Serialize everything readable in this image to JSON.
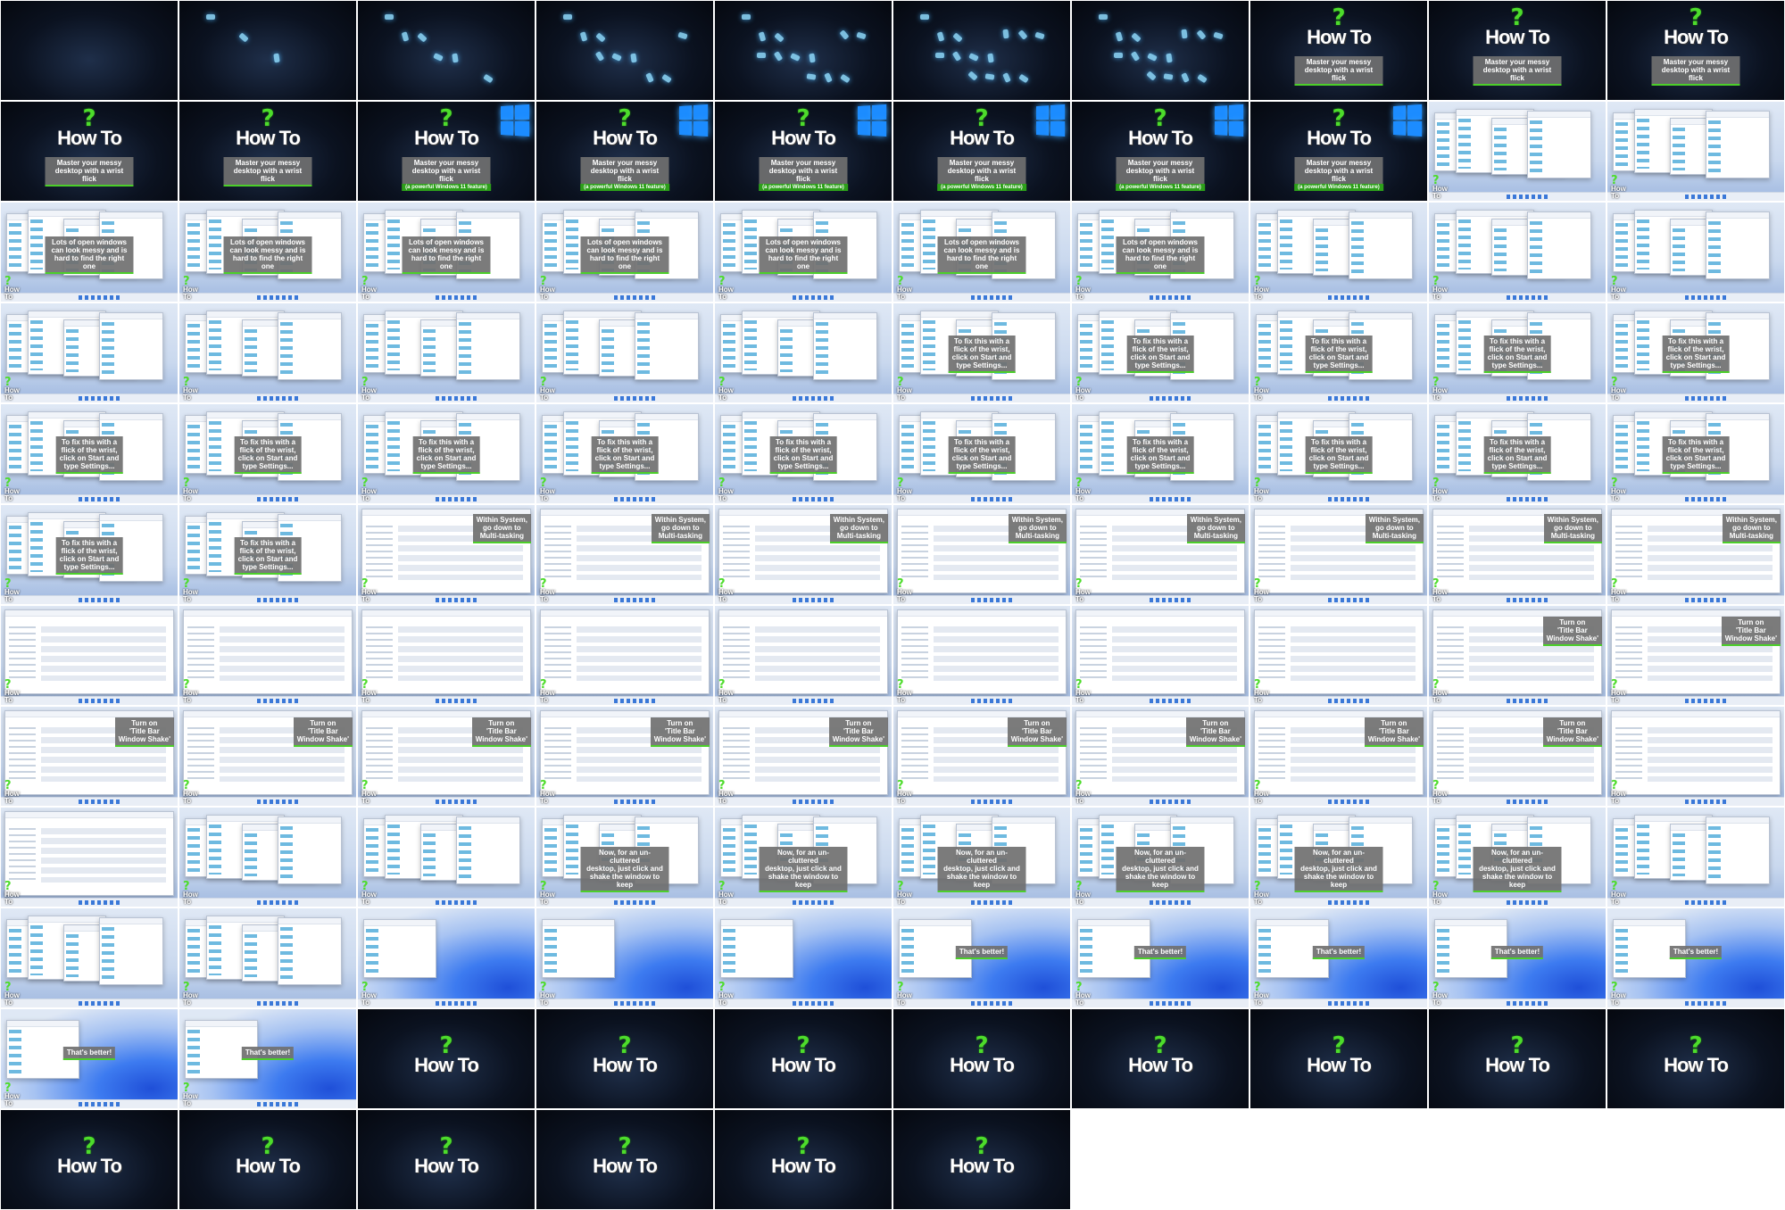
{
  "sheet": {
    "columns": 10,
    "rows": 12,
    "filled_frames": 116
  },
  "brand": {
    "logo_mark": "?",
    "logo_text": "How To",
    "accent_color": "#4ddc2b",
    "windows_color": "#1c8cff"
  },
  "captions": {
    "intro_title": "Master your messy\ndesktop with a wrist flick",
    "intro_sub": "(a powerful Windows 11 feature)",
    "messy": "Lots of open windows\ncan look messy and is\nhard to find the right one",
    "start": "To fix this with a\nflick of the wrist,\nclick on Start and\ntype Settings...",
    "system": "Within System,\ngo down to\nMulti-tasking",
    "shake": "Turn on\n'Title Bar\nWindow Shake'",
    "uncluttered": "Now, for an un-cluttered\ndesktop, just click and\nshake the window to keep",
    "better": "That's better!"
  },
  "frames": [
    "dark",
    "dark",
    "dark",
    "dark",
    "dark",
    "dark",
    "dark",
    "intro",
    "intro",
    "intro",
    "intro",
    "intro",
    "intro_sub",
    "intro_sub",
    "intro_sub",
    "intro_sub",
    "intro_sub",
    "intro_sub",
    "desk",
    "desk",
    "messy",
    "messy",
    "messy",
    "messy",
    "messy",
    "messy",
    "messy",
    "desk",
    "desk",
    "desk",
    "desk",
    "desk",
    "desk",
    "desk",
    "desk",
    "start",
    "start",
    "start",
    "start",
    "start",
    "start",
    "start",
    "start",
    "start",
    "start",
    "start",
    "start",
    "start",
    "start",
    "start",
    "start",
    "start",
    "system",
    "system",
    "system",
    "system",
    "system",
    "system",
    "system",
    "system",
    "settings",
    "settings",
    "settings",
    "settings",
    "settings",
    "settings",
    "settings",
    "settings",
    "shake",
    "shake",
    "shake",
    "shake",
    "shake",
    "shake",
    "shake",
    "shake",
    "shake",
    "shake",
    "shake",
    "settings",
    "settings",
    "desk",
    "desk",
    "uncluttered",
    "uncluttered",
    "uncluttered",
    "uncluttered",
    "uncluttered",
    "uncluttered",
    "desk",
    "desk",
    "desk",
    "bloom",
    "bloom",
    "bloom",
    "better",
    "better",
    "better",
    "better",
    "better",
    "better",
    "better",
    "logo",
    "logo",
    "logo",
    "logo",
    "logo",
    "logo",
    "logo",
    "logo",
    "logo",
    "logo",
    "logo",
    "logo",
    "logo",
    "logo"
  ]
}
